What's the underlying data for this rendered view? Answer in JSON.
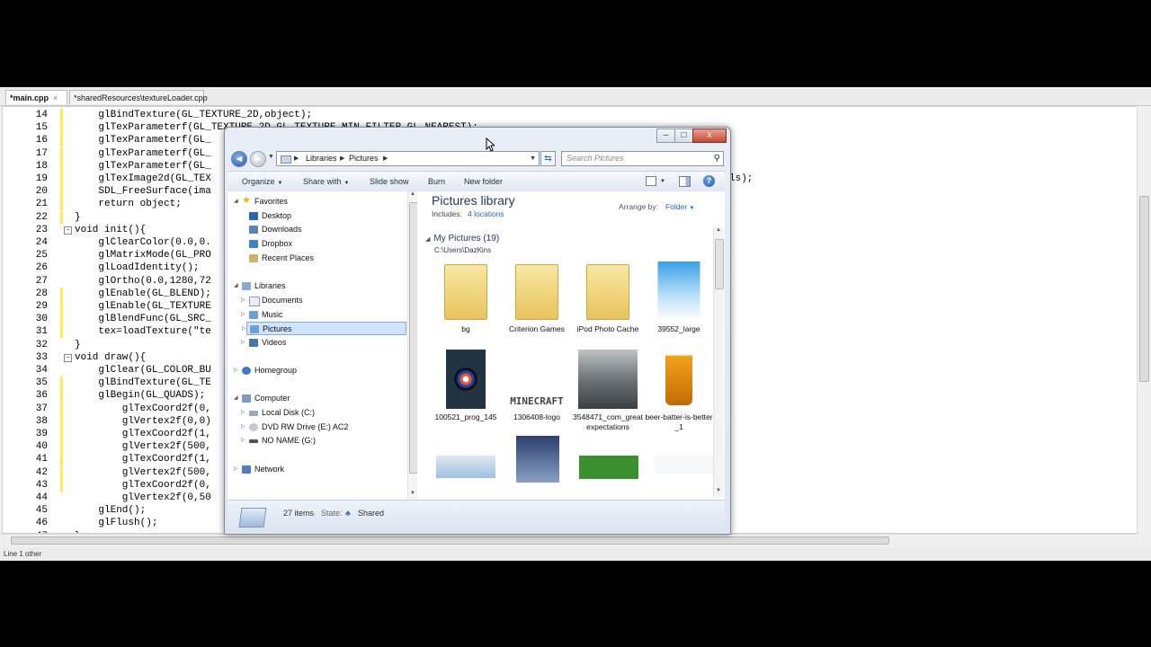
{
  "editor": {
    "tabs": [
      {
        "label": "*main.cpp",
        "active": true
      },
      {
        "label": "*sharedResources\\textureLoader.cpp",
        "active": false
      }
    ],
    "status_text": "Line 1 other",
    "lines": [
      {
        "n": "14",
        "text": "    glBindTexture(GL_TEXTURE_2D,object);",
        "changed": true
      },
      {
        "n": "15",
        "text": "    glTexParameterf(GL_TEXTURE_2D,GL_TEXTURE_MIN_FILTER,GL_NEAREST);",
        "changed": true
      },
      {
        "n": "16",
        "text": "    glTexParameterf(GL_",
        "changed": true
      },
      {
        "n": "17",
        "text": "    glTexParameterf(GL_",
        "changed": true
      },
      {
        "n": "18",
        "text": "    glTexParameterf(GL_",
        "changed": true
      },
      {
        "n": "19",
        "text": "    glTexImage2d(GL_TEX",
        "changed": true,
        "tail": "ls);"
      },
      {
        "n": "20",
        "text": "    SDL_FreeSurface(ima",
        "changed": true
      },
      {
        "n": "21",
        "text": "    return object;",
        "changed": true
      },
      {
        "n": "22",
        "text": "}",
        "changed": true
      },
      {
        "n": "23",
        "text": "void init(){",
        "fold": true
      },
      {
        "n": "24",
        "text": "    glClearColor(0.0,0.",
        "changed": false
      },
      {
        "n": "25",
        "text": "    glMatrixMode(GL_PRO",
        "changed": false
      },
      {
        "n": "26",
        "text": "    glLoadIdentity();",
        "changed": false
      },
      {
        "n": "27",
        "text": "    glOrtho(0.0,1280,72",
        "changed": false
      },
      {
        "n": "28",
        "text": "    glEnable(GL_BLEND);",
        "changed": true
      },
      {
        "n": "29",
        "text": "    glEnable(GL_TEXTURE",
        "changed": true
      },
      {
        "n": "30",
        "text": "    glBlendFunc(GL_SRC_",
        "changed": true
      },
      {
        "n": "31",
        "text": "    tex=loadTexture(\"te",
        "changed": true
      },
      {
        "n": "32",
        "text": "}",
        "changed": false
      },
      {
        "n": "33",
        "text": "void draw(){",
        "fold": true
      },
      {
        "n": "34",
        "text": "    glClear(GL_COLOR_BU",
        "changed": false
      },
      {
        "n": "35",
        "text": "    glBindTexture(GL_TE",
        "changed": true
      },
      {
        "n": "36",
        "text": "    glBegin(GL_QUADS);",
        "changed": true
      },
      {
        "n": "37",
        "text": "        glTexCoord2f(0,",
        "changed": true
      },
      {
        "n": "38",
        "text": "        glVertex2f(0,0)",
        "changed": true
      },
      {
        "n": "39",
        "text": "        glTexCoord2f(1,",
        "changed": true
      },
      {
        "n": "40",
        "text": "        glVertex2f(500,",
        "changed": true
      },
      {
        "n": "41",
        "text": "        glTexCoord2f(1,",
        "changed": true
      },
      {
        "n": "42",
        "text": "        glVertex2f(500,",
        "changed": true
      },
      {
        "n": "43",
        "text": "        glTexCoord2f(0,",
        "changed": true
      },
      {
        "n": "44",
        "text": "        glVertex2f(0,50",
        "changed": false
      },
      {
        "n": "45",
        "text": "    glEnd();",
        "changed": false
      },
      {
        "n": "46",
        "text": "    glFlush();",
        "changed": false
      },
      {
        "n": "47",
        "text": "}",
        "changed": false
      }
    ]
  },
  "explorer": {
    "window_buttons": {
      "minimize": "–",
      "maximize": "□",
      "close": "x"
    },
    "breadcrumb": [
      "Libraries",
      "Pictures"
    ],
    "search_placeholder": "Search Pictures",
    "toolbar": {
      "organize": "Organize",
      "share_with": "Share with",
      "slide_show": "Slide show",
      "burn": "Burn",
      "new_folder": "New folder",
      "help": "?"
    },
    "nav": {
      "favorites": "Favorites",
      "desktop": "Desktop",
      "downloads": "Downloads",
      "dropbox": "Dropbox",
      "recent_places": "Recent Places",
      "libraries": "Libraries",
      "documents": "Documents",
      "music": "Music",
      "pictures": "Pictures",
      "videos": "Videos",
      "homegroup": "Homegroup",
      "computer": "Computer",
      "local_disk": "Local Disk (C:)",
      "dvd_drive": "DVD RW Drive (E:) AC2",
      "no_name": "NO NAME (G:)",
      "network": "Network"
    },
    "library": {
      "title": "Pictures library",
      "includes_label": "Includes:",
      "includes_link": "4 locations",
      "arrange_label": "Arrange by:",
      "arrange_value": "Folder"
    },
    "group": {
      "title": "My Pictures (19)",
      "path": "C:\\Users\\DazKins"
    },
    "files": [
      {
        "name": "bg",
        "kind": "folder"
      },
      {
        "name": "Criterion Games",
        "kind": "folder"
      },
      {
        "name": "iPod Photo Cache",
        "kind": "folder"
      },
      {
        "name": "39552_large",
        "kind": "sky"
      },
      {
        "name": "100521_prog_145",
        "kind": "target"
      },
      {
        "name": "1306408-logo",
        "kind": "minecraft"
      },
      {
        "name": "3548471_com_greatexpectations",
        "kind": "movie"
      },
      {
        "name": "beer-batter-is-better_1",
        "kind": "beer"
      }
    ],
    "minecraft_logo_text": "MINECRAFT",
    "status": {
      "count": "27 items",
      "state_label": "State:",
      "state_value": "Shared"
    }
  }
}
